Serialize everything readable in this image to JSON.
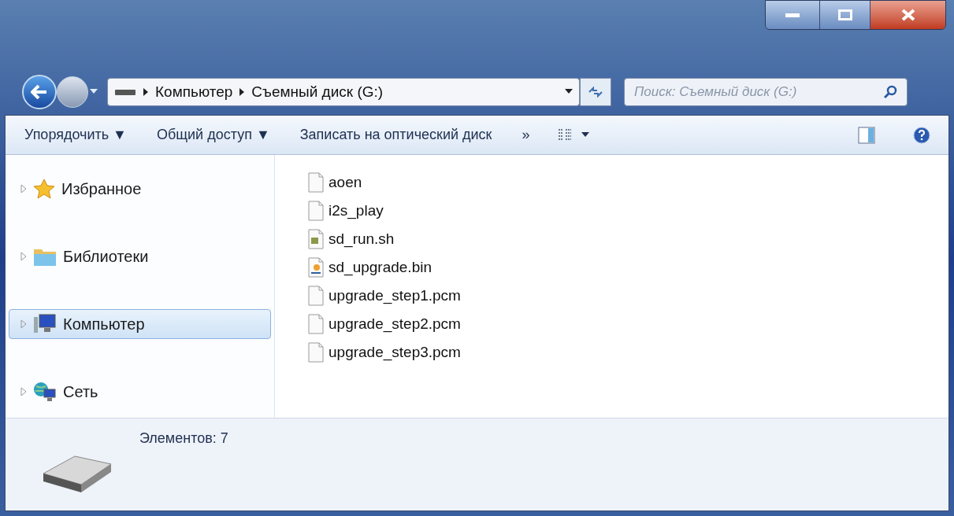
{
  "address_bar": {
    "crumbs": [
      "Компьютер",
      "Съемный диск (G:)"
    ]
  },
  "search": {
    "placeholder": "Поиск: Съемный диск (G:)"
  },
  "toolbar": {
    "items": [
      "Упорядочить ▼",
      "Общий доступ ▼",
      "Записать на оптический диск",
      "»"
    ]
  },
  "sidebar": {
    "items": [
      {
        "label": "Избранное",
        "kind": "star",
        "selected": false
      },
      {
        "label": "Библиотеки",
        "kind": "library",
        "selected": false
      },
      {
        "label": "Компьютер",
        "kind": "computer",
        "selected": true
      },
      {
        "label": "Сеть",
        "kind": "network",
        "selected": false
      }
    ]
  },
  "files": [
    {
      "name": "aoen",
      "kind": "plain"
    },
    {
      "name": "i2s_play",
      "kind": "plain"
    },
    {
      "name": "sd_run.sh",
      "kind": "script"
    },
    {
      "name": "sd_upgrade.bin",
      "kind": "binary"
    },
    {
      "name": "upgrade_step1.pcm",
      "kind": "plain"
    },
    {
      "name": "upgrade_step2.pcm",
      "kind": "plain"
    },
    {
      "name": "upgrade_step3.pcm",
      "kind": "plain"
    }
  ],
  "details": {
    "count": "Элементов: 7"
  }
}
